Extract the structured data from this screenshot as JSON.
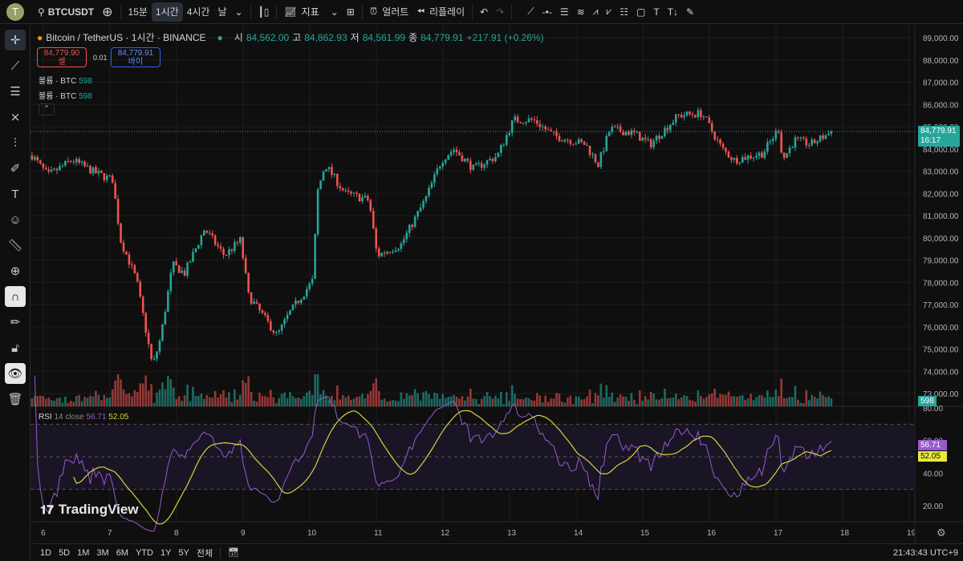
{
  "toolbar": {
    "avatar": "T",
    "symbol": "BTCUSDT",
    "intervals": [
      "15분",
      "1시간",
      "4시간",
      "날"
    ],
    "selected_interval": "1시간",
    "indicators": "지표",
    "alert": "얼러트",
    "replay": "리플레이"
  },
  "legend": {
    "title": "Bitcoin / TetherUS · 1시간 · BINANCE",
    "o_label": "시",
    "o": "84,562.00",
    "h_label": "고",
    "h": "84,862.93",
    "l_label": "저",
    "l": "84,561.99",
    "c_label": "종",
    "c": "84,779.91",
    "change": "+217.91 (+0.26%)"
  },
  "trade": {
    "sell_price": "84,779.90",
    "sell_label": "셀",
    "spread": "0.01",
    "buy_price": "84,779.91",
    "buy_label": "바이"
  },
  "volume_legend": [
    {
      "label": "볼륨 · BTC",
      "value": "598"
    },
    {
      "label": "볼륨 · BTC",
      "value": "598"
    }
  ],
  "rsi_legend": {
    "label": "RSI",
    "params": "14 close",
    "rsi": "56.71",
    "ma": "52.05"
  },
  "price_tag": {
    "price": "84,779.91",
    "countdown": "16:17"
  },
  "volume_tag": "598",
  "rsi_tags": {
    "rsi": "56.71",
    "ma": "52.05"
  },
  "watermark": "TradingView",
  "ranges": [
    "1D",
    "5D",
    "1M",
    "3M",
    "6M",
    "YTD",
    "1Y",
    "5Y",
    "전체"
  ],
  "clock": "21:43:43 UTC+9",
  "colors": {
    "up": "#26a69a",
    "down": "#ef5350",
    "rsi": "#9b59d0",
    "rsi_ma": "#d4d43a"
  },
  "chart_data": {
    "type": "candlestick",
    "interval": "1h",
    "price_ticks": [
      "89,000.00",
      "88,000.00",
      "87,000.00",
      "86,000.00",
      "85,000.00",
      "84,000.00",
      "83,000.00",
      "82,000.00",
      "81,000.00",
      "80,000.00",
      "79,000.00",
      "78,000.00",
      "77,000.00",
      "76,000.00",
      "75,000.00",
      "74,000.00",
      "73,000.00"
    ],
    "ylim": [
      72600,
      89400
    ],
    "x_ticks": [
      "6",
      "7",
      "8",
      "9",
      "10",
      "11",
      "12",
      "13",
      "14",
      "15",
      "16",
      "17",
      "18",
      "19"
    ],
    "xlim": [
      5.83,
      19.5
    ],
    "close_path": [
      [
        5.83,
        83700
      ],
      [
        6.07,
        82800
      ],
      [
        6.43,
        83500
      ],
      [
        6.8,
        82900
      ],
      [
        7.04,
        82600
      ],
      [
        7.16,
        79900
      ],
      [
        7.4,
        78100
      ],
      [
        7.64,
        74200
      ],
      [
        7.76,
        75500
      ],
      [
        7.94,
        78800
      ],
      [
        8.12,
        78400
      ],
      [
        8.42,
        80400
      ],
      [
        8.72,
        79200
      ],
      [
        8.96,
        79900
      ],
      [
        9.08,
        77400
      ],
      [
        9.51,
        75600
      ],
      [
        9.69,
        76600
      ],
      [
        10.05,
        78100
      ],
      [
        10.11,
        82000
      ],
      [
        10.23,
        83300
      ],
      [
        10.53,
        82000
      ],
      [
        10.89,
        81700
      ],
      [
        11.01,
        79200
      ],
      [
        11.37,
        79700
      ],
      [
        11.73,
        81700
      ],
      [
        11.98,
        83500
      ],
      [
        12.16,
        84000
      ],
      [
        12.46,
        83100
      ],
      [
        12.82,
        83700
      ],
      [
        13.06,
        85300
      ],
      [
        13.36,
        85300
      ],
      [
        13.66,
        84600
      ],
      [
        14.14,
        84200
      ],
      [
        14.33,
        83300
      ],
      [
        14.51,
        84900
      ],
      [
        14.87,
        84700
      ],
      [
        15.11,
        84200
      ],
      [
        15.53,
        85500
      ],
      [
        15.89,
        85600
      ],
      [
        16.19,
        84000
      ],
      [
        16.37,
        83500
      ],
      [
        16.8,
        83800
      ],
      [
        17.04,
        84900
      ],
      [
        17.1,
        83500
      ],
      [
        17.28,
        84400
      ],
      [
        17.52,
        84200
      ],
      [
        17.84,
        84780
      ]
    ],
    "rsi_ticks": [
      "80.00",
      "60.00",
      "40.00",
      "20.00"
    ],
    "rsi_bands": [
      30,
      50,
      70
    ],
    "rsi_period": 14
  }
}
